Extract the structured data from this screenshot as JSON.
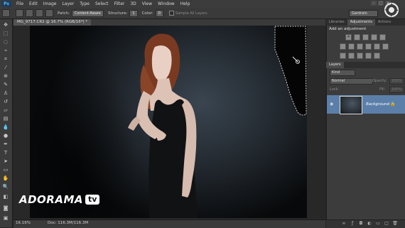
{
  "app": {
    "logo": "Ps"
  },
  "menu": [
    "File",
    "Edit",
    "Image",
    "Layer",
    "Type",
    "Select",
    "Filter",
    "3D",
    "View",
    "Window",
    "Help"
  ],
  "window_controls": {
    "minimize": "–",
    "restore": "▢",
    "close": "×"
  },
  "options_bar": {
    "patch_label": "Patch:",
    "patch_value": "Content-Aware",
    "structure_label": "Structure:",
    "structure_value": "1",
    "color_label": "Color:",
    "color_value": "0",
    "sample_all_layers": "Sample All Layers",
    "workspace": "Gardrain"
  },
  "document": {
    "tab_title": "MG_9717.CR2 @ 16.7% (RGB/16*) *",
    "zoom": "16.16%",
    "doc_info": "Doc: 116.3M/116.3M"
  },
  "watermark": {
    "brand": "ADORAMA",
    "tv": "tv"
  },
  "panels": {
    "top_tabs": [
      "Libraries",
      "Adjustments",
      "Actions"
    ],
    "active_top_tab": "Adjustments",
    "adjustments_title": "Add an adjustment",
    "layers_tab": "Layers",
    "kind_label": "Kind",
    "blend_mode": "Normal",
    "opacity_label": "Opacity:",
    "opacity_value": "100%",
    "lock_label": "Lock:",
    "fill_label": "Fill:",
    "fill_value": "100%",
    "layer_name": "Background"
  },
  "icons": {
    "eye": "eye-icon",
    "lock": "lock-icon",
    "link": "link-icon",
    "fx": "fx-icon"
  },
  "colors": {
    "menu_bg": "#3c3c3c",
    "selected_layer": "#5b7fa8",
    "ps_blue": "#59b6f5"
  }
}
